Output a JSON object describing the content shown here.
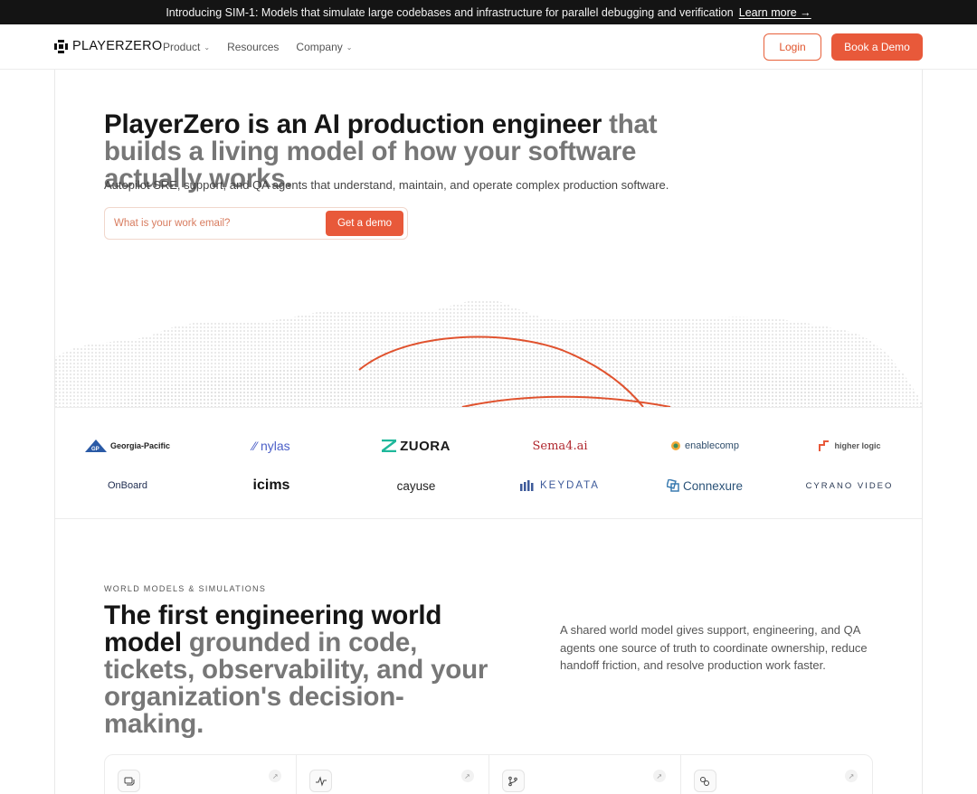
{
  "announcement": {
    "text": "Introducing SIM-1: Models that simulate large codebases and infrastructure for parallel debugging and verification",
    "link_label": "Learn more →"
  },
  "nav": {
    "brand": "PLAYERZERO",
    "links": [
      {
        "label": "Product",
        "icon": "chevron-down-icon"
      },
      {
        "label": "Resources"
      },
      {
        "label": "Company",
        "icon": "chevron-down-icon"
      }
    ],
    "login_label": "Login",
    "book_demo_label": "Book a Demo"
  },
  "hero": {
    "title_dark": "PlayerZero is an AI production engineer",
    "title_muted": "that builds a living model of how your software actually works.",
    "subtitle": "Autopilot SRE, support, and QA agents that understand, maintain, and operate complex production software.",
    "email_placeholder": "What is your work email?",
    "cta_label": "Get a demo"
  },
  "customer_logos": [
    "Georgia-Pacific",
    "nylas",
    "ZUORA",
    "Sema4.ai",
    "enablecomp",
    "higher logic",
    "OnBoard",
    "icims",
    "cayuse",
    "KEYDATA",
    "Connexure",
    "CYRANO VIDEO"
  ],
  "world_models": {
    "eyebrow": "WORLD MODELS & SIMULATIONS",
    "title_dark": "The first engineering world model",
    "title_muted": "grounded in code, tickets, observability, and your organization's decision-making.",
    "description": "A shared world model gives support, engineering, and QA agents one source of truth to coordinate ownership, reduce handoff friction, and resolve production work faster."
  },
  "feature_cards": [
    {
      "icon": "chat-icon"
    },
    {
      "icon": "activity-icon"
    },
    {
      "icon": "branch-icon"
    },
    {
      "icon": "link-icon"
    }
  ],
  "colors": {
    "accent": "#e8593a",
    "announcement_bg": "#141414",
    "text_muted": "#777777"
  }
}
